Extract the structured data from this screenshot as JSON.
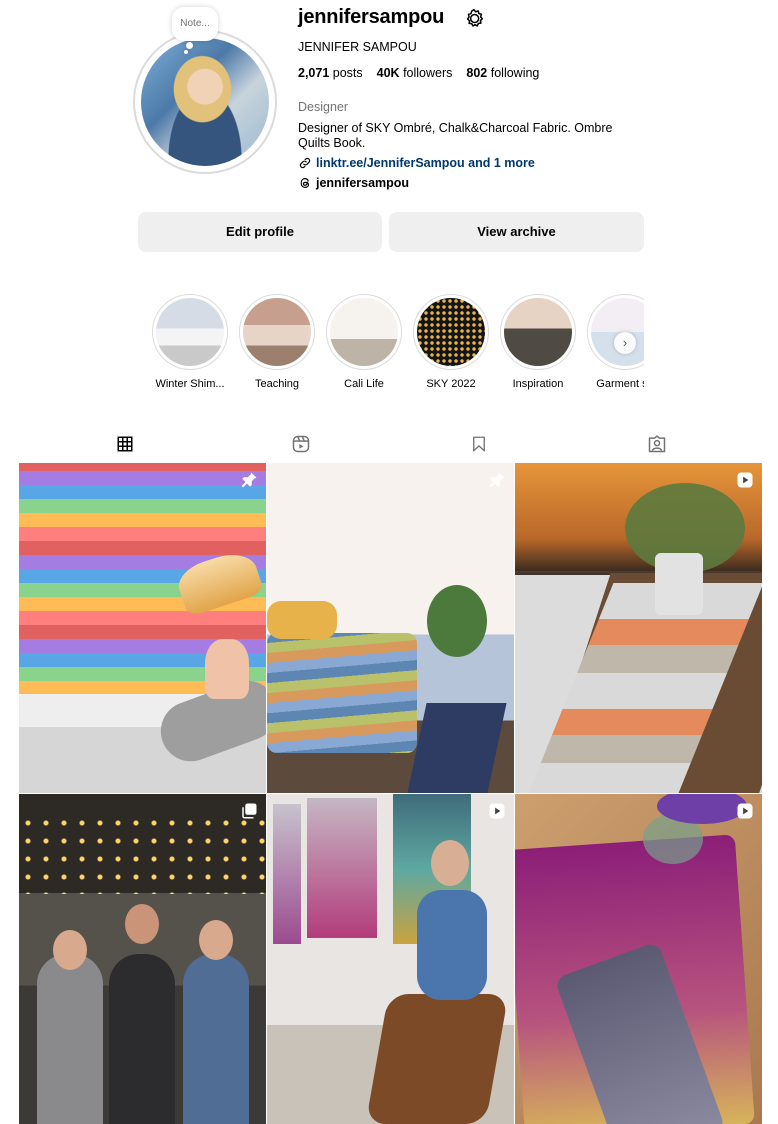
{
  "profile": {
    "note": "Note...",
    "username": "jennifersampou",
    "full_name": "JENNIFER SAMPOU",
    "posts_count": "2,071",
    "posts_label": "posts",
    "followers_count": "40K",
    "followers_label": "followers",
    "following_count": "802",
    "following_label": "following",
    "category": "Designer",
    "bio": "Designer of SKY Ombré, Chalk&Charcoal Fabric. Ombre Quilts Book.",
    "link_text": "linktr.ee/JenniferSampou and 1 more",
    "threads_handle": "jennifersampou"
  },
  "buttons": {
    "edit_profile": "Edit profile",
    "view_archive": "View archive"
  },
  "highlights": [
    {
      "label": "Winter Shim..."
    },
    {
      "label": "Teaching"
    },
    {
      "label": "Cali Life"
    },
    {
      "label": "SKY 2022"
    },
    {
      "label": "Inspiration"
    },
    {
      "label": "Garment se"
    }
  ],
  "tabs": [
    {
      "icon": "grid-icon",
      "active": true
    },
    {
      "icon": "reels-icon",
      "active": false
    },
    {
      "icon": "saved-icon",
      "active": false
    },
    {
      "icon": "tagged-icon",
      "active": false
    }
  ],
  "posts": [
    {
      "badge": "pin-icon"
    },
    {
      "badge": "pin-icon"
    },
    {
      "badge": "reel-icon"
    },
    {
      "badge": "carousel-icon"
    },
    {
      "badge": "reel-icon"
    },
    {
      "badge": "reel-icon"
    }
  ]
}
